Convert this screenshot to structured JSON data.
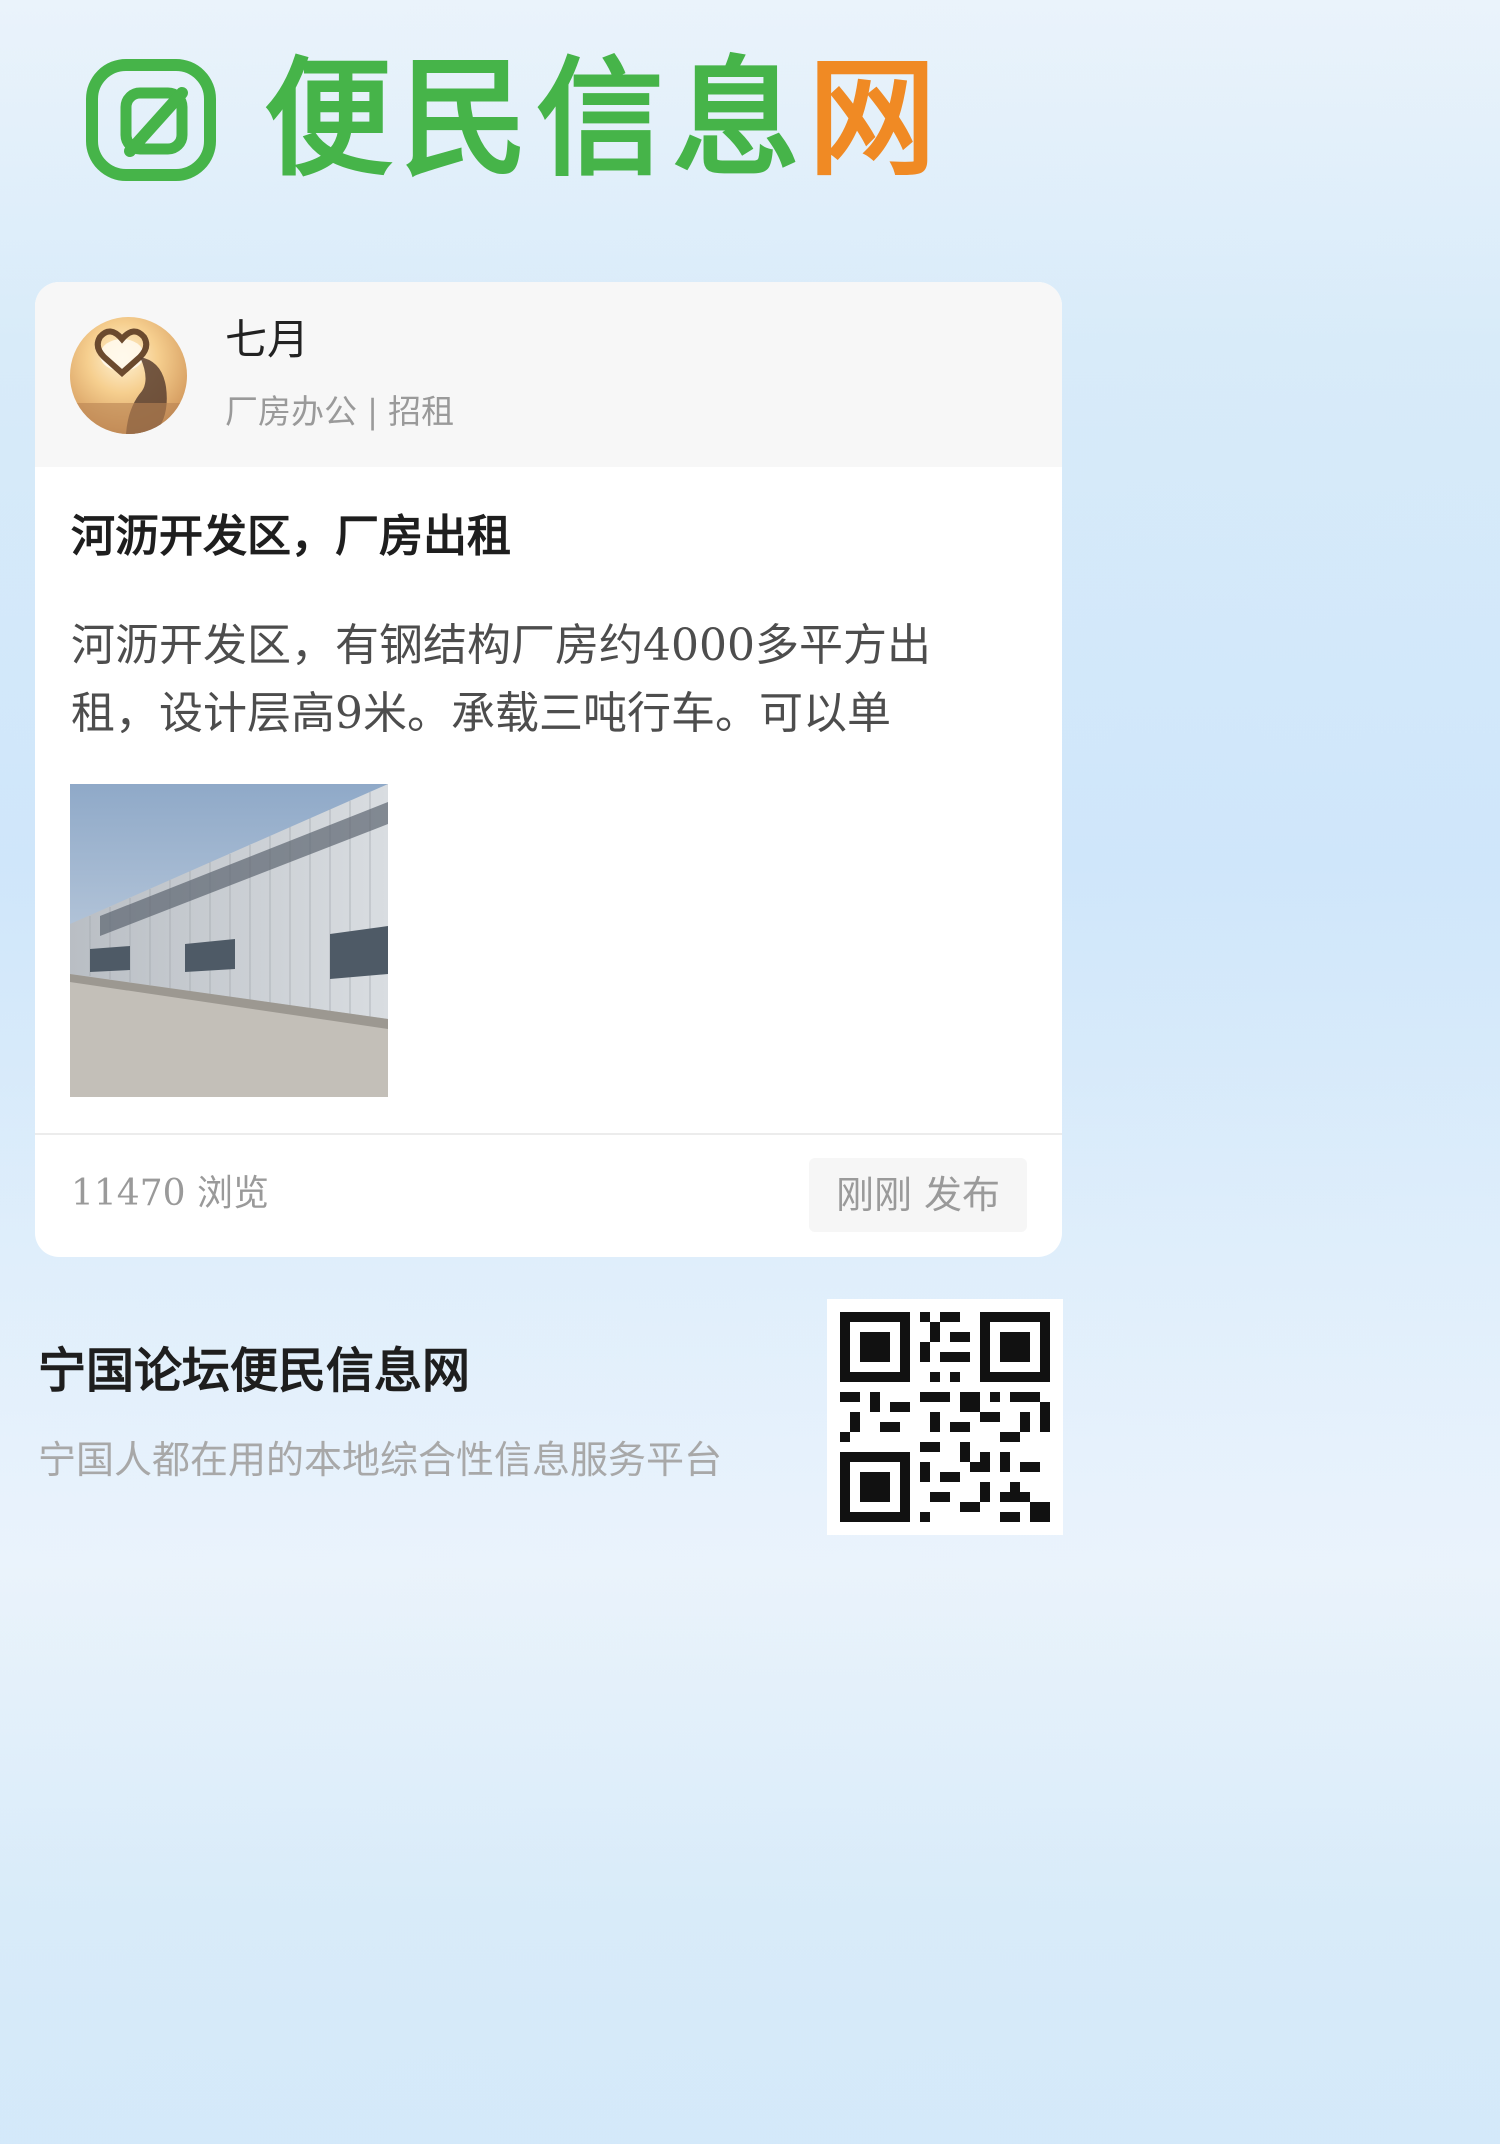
{
  "brand": {
    "logo_icon": "cutting-board-d-logo-icon",
    "logo_text_parts": [
      "便",
      "民",
      "信",
      "息",
      "网"
    ],
    "colors": {
      "green": "#46b449",
      "orange": "#f08a24"
    }
  },
  "post": {
    "author": {
      "name": "七月",
      "avatar_icon": "avatar-photo"
    },
    "category": "厂房办公",
    "separator": "|",
    "type": "招租",
    "title": "河沥开发区，厂房出租",
    "body": "河沥开发区，有钢结构厂房约4000多平方出租，设计层高9米。承载三吨行车。可以单",
    "image_icon": "factory-building-photo",
    "views": "11470 浏览",
    "published": "刚刚 发布"
  },
  "footer": {
    "title": "宁国论坛便民信息网",
    "subtitle": "宁国人都在用的本地综合性信息服务平台",
    "qr_icon": "qr-code-icon"
  }
}
